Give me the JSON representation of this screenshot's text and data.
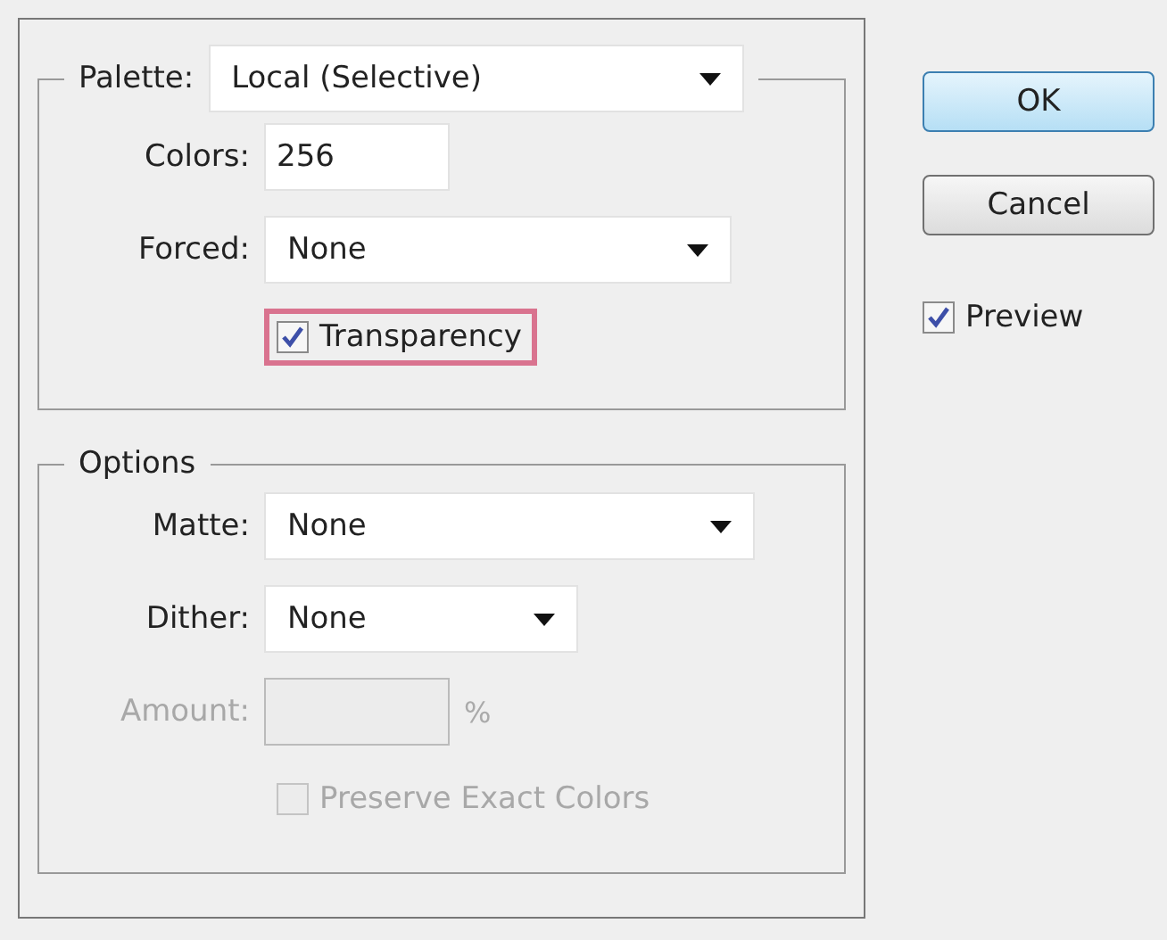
{
  "palette_group": {
    "rows": [
      {
        "kind": "select",
        "label": "Palette:",
        "value": "Local (Selective)",
        "disabled": false,
        "highlighted": false
      },
      {
        "kind": "input",
        "label": "Colors:",
        "value": "256",
        "disabled": false,
        "highlighted": false
      },
      {
        "kind": "select",
        "label": "Forced:",
        "value": "None",
        "disabled": false,
        "highlighted": false
      },
      {
        "kind": "checkbox",
        "label": "Transparency",
        "checked": true,
        "disabled": false,
        "highlighted": true
      }
    ]
  },
  "options_group": {
    "title": "Options",
    "rows": [
      {
        "kind": "select",
        "label": "Matte:",
        "value": "None",
        "disabled": false,
        "highlighted": false
      },
      {
        "kind": "select",
        "label": "Dither:",
        "value": "None",
        "disabled": false,
        "highlighted": false
      },
      {
        "kind": "input",
        "label": "Amount:",
        "unit": "%",
        "disabled": true,
        "highlighted": false
      },
      {
        "kind": "checkbox",
        "label": "Preserve Exact Colors",
        "checked": false,
        "disabled": true,
        "highlighted": false
      }
    ]
  },
  "buttons": [
    {
      "label": "OK",
      "default": true
    },
    {
      "label": "Cancel",
      "default": false
    }
  ],
  "preview": {
    "label": "Preview",
    "checked": true
  }
}
